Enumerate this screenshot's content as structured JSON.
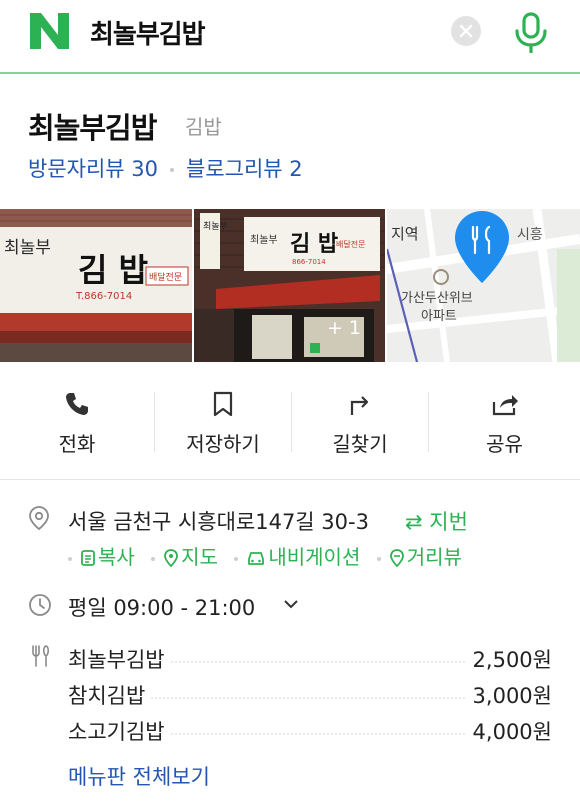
{
  "search": {
    "query": "최놀부김밥"
  },
  "place": {
    "name": "최놀부김밥",
    "category": "김밥",
    "visitor_reviews": "방문자리뷰 30",
    "blog_reviews": "블로그리뷰 2"
  },
  "photos": {
    "more_count": "+ 1",
    "sign1": {
      "top": "최놀부",
      "main": "김 밥",
      "phone": "T.866-7014",
      "tag": "배달전문"
    },
    "sign2": {
      "left": "최놀부",
      "main": "김 밥",
      "phone": "866-7014",
      "tag": "배달전문"
    },
    "map": {
      "station": "지역",
      "road": "시흥",
      "apartment_line1": "가산두산위브",
      "apartment_line2": "아파트"
    }
  },
  "actions": [
    {
      "label": "전화",
      "icon": "phone-icon"
    },
    {
      "label": "저장하기",
      "icon": "bookmark-icon"
    },
    {
      "label": "길찾기",
      "icon": "directions-icon"
    },
    {
      "label": "공유",
      "icon": "share-icon"
    }
  ],
  "info": {
    "address": "서울 금천구 시흥대로147길 30-3",
    "jibun_toggle": "⇄ 지번",
    "links": [
      {
        "label": "복사",
        "icon": "copy-icon"
      },
      {
        "label": "지도",
        "icon": "map-pin-icon"
      },
      {
        "label": "내비게이션",
        "icon": "car-icon"
      },
      {
        "label": "거리뷰",
        "icon": "streetview-icon"
      }
    ],
    "hours": "평일 09:00 - 21:00",
    "menu": [
      {
        "name": "최놀부김밥",
        "price": "2,500원"
      },
      {
        "name": "참치김밥",
        "price": "3,000원"
      },
      {
        "name": "소고기김밥",
        "price": "4,000원"
      }
    ],
    "menu_all": "메뉴판 전체보기"
  },
  "colors": {
    "brand_green": "#2db253",
    "link_blue": "#2356b0",
    "pin_blue": "#1f8ded"
  }
}
